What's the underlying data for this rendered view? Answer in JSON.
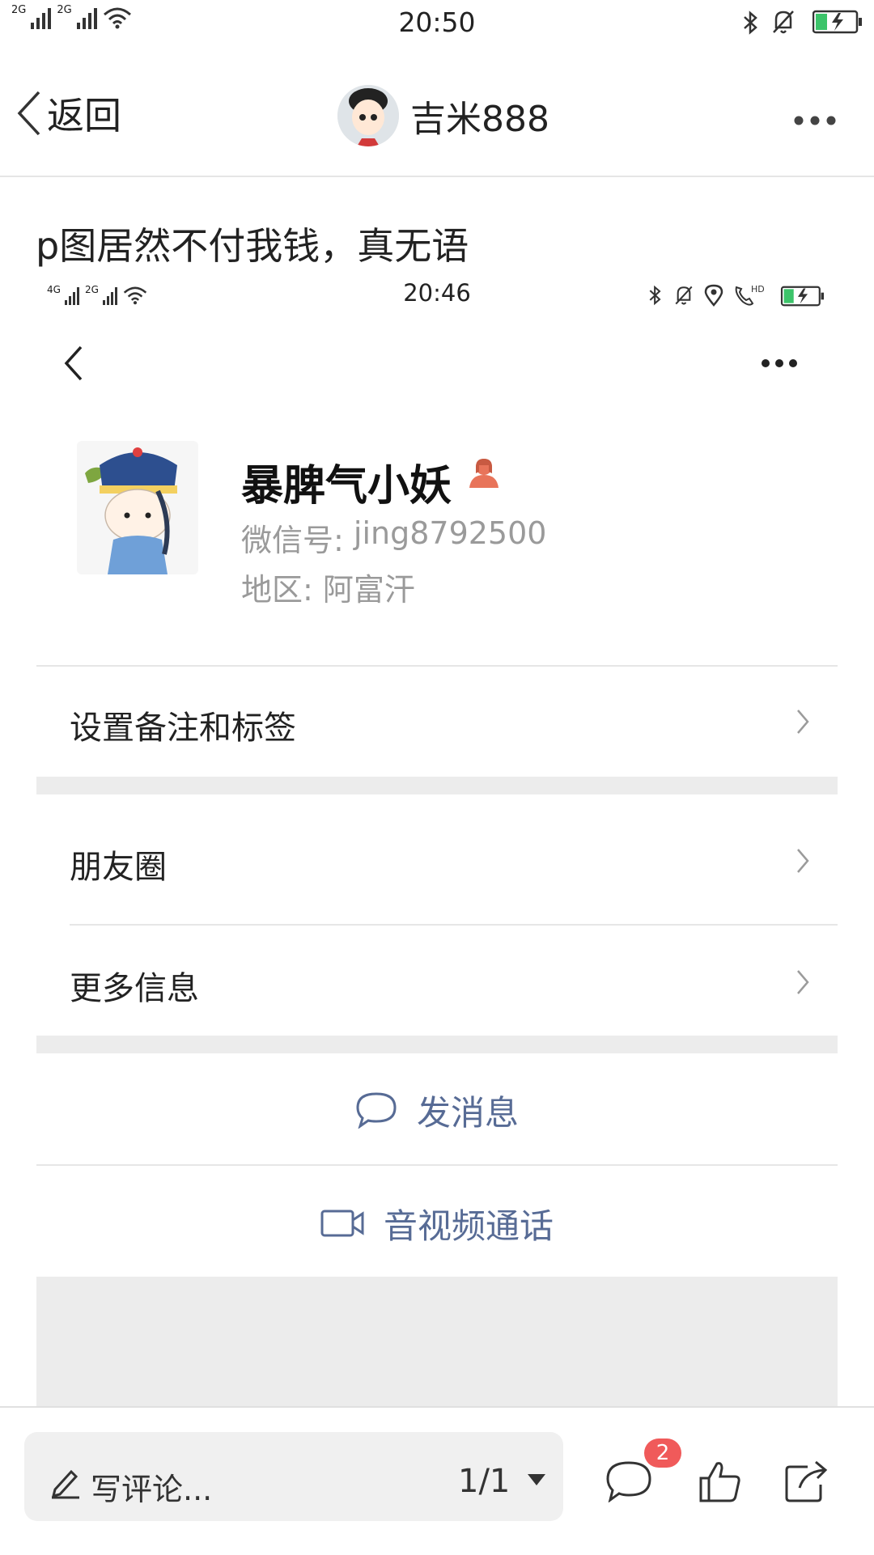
{
  "status_bar": {
    "time": "20:50",
    "signal_1": "2G",
    "signal_2": "2G",
    "icons": [
      "signal-icon",
      "wifi-icon",
      "bluetooth-icon",
      "mute-icon",
      "battery-charging-icon"
    ]
  },
  "nav": {
    "back_label": "返回",
    "username": "吉米888",
    "more_icon": "more-dots-icon"
  },
  "post": {
    "title": "p图居然不付我钱，真无语"
  },
  "embedded": {
    "status_bar": {
      "time": "20:46",
      "signal_1": "4G",
      "signal_2": "2G",
      "icons": [
        "signal-icon",
        "wifi-icon",
        "bluetooth-icon",
        "mute-icon",
        "location-icon",
        "hd-call-icon",
        "battery-charging-icon"
      ]
    },
    "profile": {
      "name": "暴脾气小妖",
      "gender_icon": "female-icon",
      "wechat_id_label": "微信号: ",
      "wechat_id": "jing8792500",
      "region_label": "地区: ",
      "region": "阿富汗"
    },
    "menu": [
      {
        "label": "设置备注和标签"
      },
      {
        "label": "朋友圈"
      },
      {
        "label": "更多信息"
      }
    ],
    "actions": {
      "message": "发消息",
      "call": "音视频通话"
    }
  },
  "toolbar": {
    "comment_placeholder": "写评论...",
    "page_indicator": "1/1",
    "comment_count": "2"
  },
  "colors": {
    "link_blue": "#576b95",
    "badge_red": "#f05a5a",
    "female_icon": "#e8745a",
    "battery_green": "#3cc46a"
  }
}
